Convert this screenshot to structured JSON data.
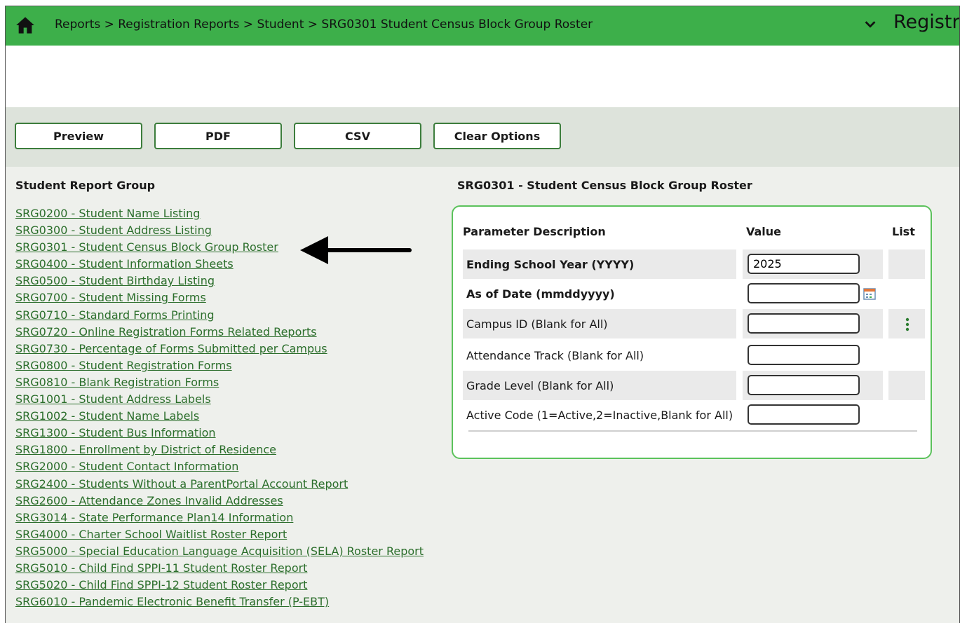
{
  "header": {
    "breadcrumb": "Reports > Registration Reports > Student > SRG0301 Student Census Block Group Roster",
    "app_title": "Registr"
  },
  "toolbar": {
    "preview_label": "Preview",
    "pdf_label": "PDF",
    "csv_label": "CSV",
    "clear_label": "Clear Options"
  },
  "report_group": {
    "title": "Student Report Group",
    "items": [
      "SRG0200 - Student Name Listing",
      "SRG0300 - Student Address Listing",
      "SRG0301 - Student Census Block Group Roster",
      "SRG0400 - Student Information Sheets",
      "SRG0500 - Student Birthday Listing",
      "SRG0700 - Student Missing Forms",
      "SRG0710 - Standard Forms Printing",
      "SRG0720 - Online Registration Forms Related Reports",
      "SRG0730 - Percentage of Forms Submitted per Campus",
      "SRG0800 - Student Registration Forms",
      "SRG0810 - Blank Registration Forms",
      "SRG1001 - Student Address Labels",
      "SRG1002 - Student Name Labels",
      "SRG1300 - Student Bus Information",
      "SRG1800 - Enrollment by District of Residence",
      "SRG2000 - Student Contact Information",
      "SRG2400 - Students Without a ParentPortal Account Report",
      "SRG2600 - Attendance Zones Invalid Addresses",
      "SRG3014 - State Performance Plan14 Information",
      "SRG4000 - Charter School Waitlist Roster Report",
      "SRG5000 - Special Education Language Acquisition (SELA) Roster Report",
      "SRG5010 - Child Find SPPI-11 Student Roster Report",
      "SRG5020 - Child Find SPPI-12 Student Roster Report",
      "SRG6010 - Pandemic Electronic Benefit Transfer (P-EBT)"
    ]
  },
  "parameters": {
    "title": "SRG0301 - Student Census Block Group Roster",
    "col_description": "Parameter Description",
    "col_value": "Value",
    "col_list": "List",
    "rows": [
      {
        "label": "Ending School Year (YYYY)",
        "value": "2025"
      },
      {
        "label": "As of Date (mmddyyyy)",
        "value": ""
      },
      {
        "label": "Campus ID (Blank for All)",
        "value": ""
      },
      {
        "label": "Attendance Track (Blank for All)",
        "value": ""
      },
      {
        "label": "Grade Level (Blank for All)",
        "value": ""
      },
      {
        "label": "Active Code (1=Active,2=Inactive,Blank for All)",
        "value": ""
      }
    ]
  },
  "icons": {
    "home": "home-icon",
    "chevron": "chevron-down-icon",
    "calendar": "calendar-icon",
    "list_picker": "kebab-menu-icon",
    "pointer_arrow": "arrow-left-icon"
  },
  "colors": {
    "header_green": "#3daf4a",
    "link_green": "#2b6e2b",
    "panel_border": "#5bc25b"
  }
}
